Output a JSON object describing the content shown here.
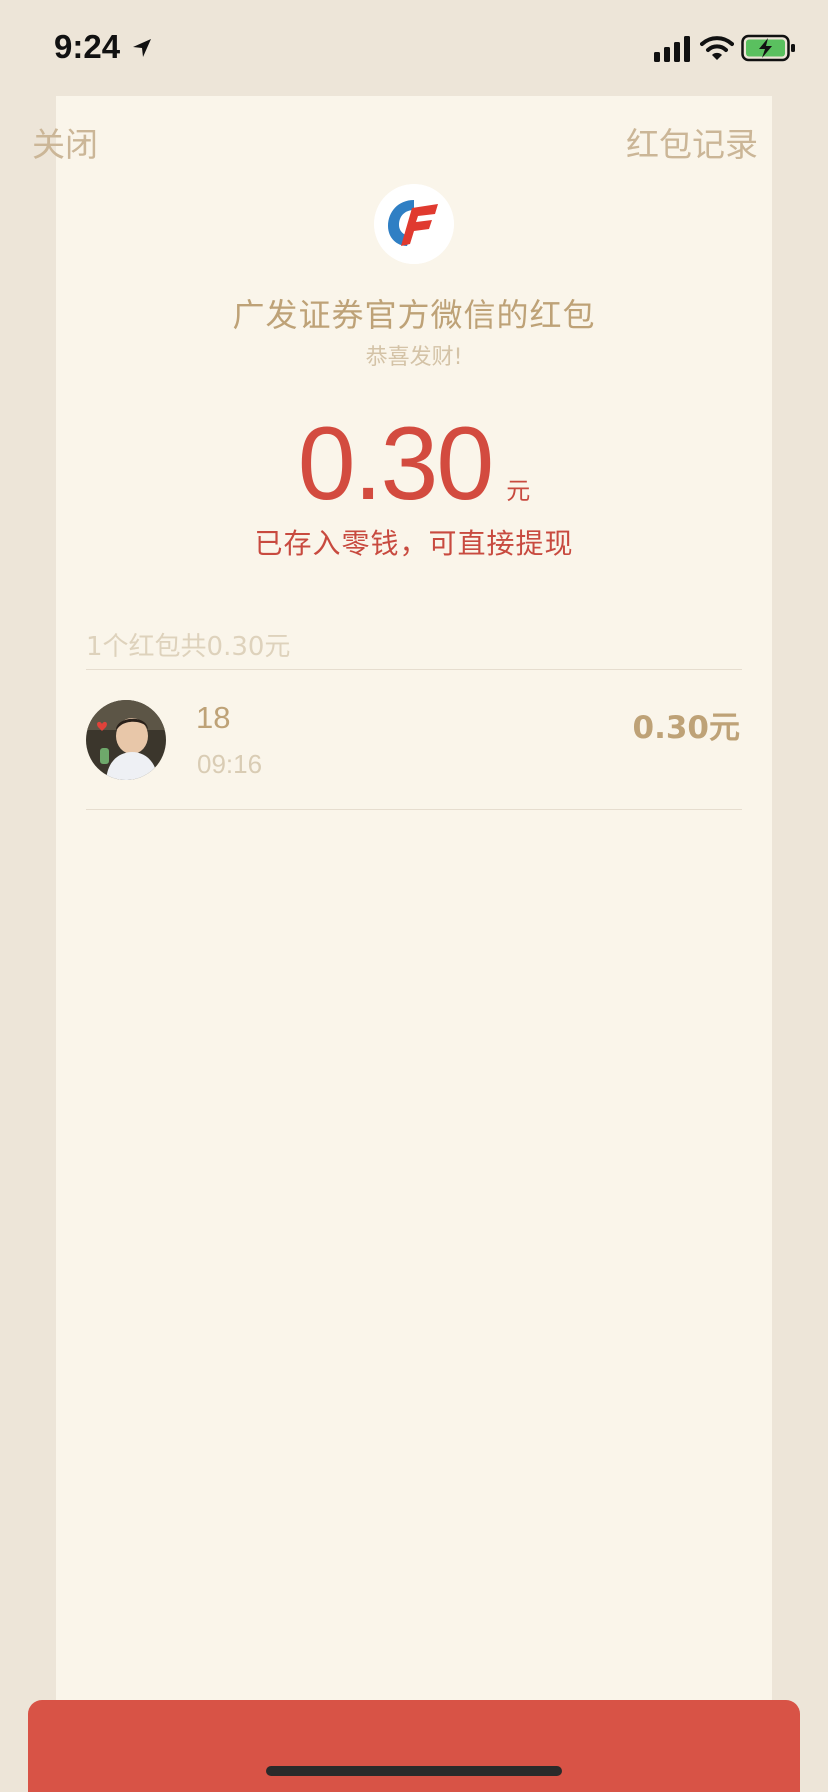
{
  "status_bar": {
    "time": "9:24",
    "icons": [
      "location-arrow-icon",
      "signal-icon",
      "wifi-icon",
      "battery-charging-icon"
    ]
  },
  "nav": {
    "close_label": "关闭",
    "records_label": "红包记录"
  },
  "packet": {
    "sender_title": "广发证券官方微信的红包",
    "blessing": "恭喜发财!",
    "amount": "0.30",
    "unit": "元",
    "stored_note": "已存入零钱，可直接提现"
  },
  "summary": "1个红包共0.30元",
  "records": [
    {
      "name": "18",
      "time": "09:16",
      "amount": "0.30元"
    }
  ],
  "colors": {
    "page_background": "#ede5d8",
    "card_background": "#faf5ea",
    "accent_gold": "#bea277",
    "amount_red": "#d34b3f",
    "bottom_bar_red": "#d85346"
  }
}
